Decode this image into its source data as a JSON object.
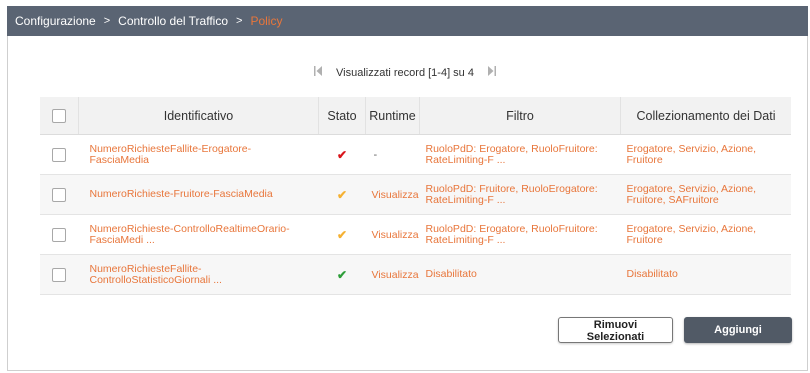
{
  "breadcrumb": {
    "items": [
      "Configurazione",
      "Controllo del Traffico",
      "Policy"
    ],
    "separator": ">"
  },
  "pager": {
    "prev_icon": "first-page-icon",
    "label": "Visualizzati record [1-4] su 4",
    "next_icon": "last-page-icon"
  },
  "table": {
    "columns": [
      "Identificativo",
      "Stato",
      "Runtime",
      "Filtro",
      "Collezionamento dei Dati"
    ],
    "rows": [
      {
        "id_line1": "NumeroRichiesteFallite-Erogatore-",
        "id_line2": "FasciaMedia",
        "stato_icon": "check-icon",
        "stato_color": "#d9161c",
        "runtime": "-",
        "filtro_line1": "RuoloPdD: Erogatore, RuoloFruitore:",
        "filtro_line2": "RateLimiting-F ...",
        "coll_line1": "Erogatore, Servizio, Azione,",
        "coll_line2": "Fruitore"
      },
      {
        "id_line1": "NumeroRichieste-Fruitore-FasciaMedia",
        "id_line2": "",
        "stato_icon": "check-icon",
        "stato_color": "#f5b133",
        "runtime": "Visualizza",
        "filtro_line1": "RuoloPdD: Fruitore, RuoloErogatore:",
        "filtro_line2": "RateLimiting-F ...",
        "coll_line1": "Erogatore, Servizio, Azione,",
        "coll_line2": "Fruitore, SAFruitore"
      },
      {
        "id_line1": "NumeroRichieste-ControlloRealtimeOrario-",
        "id_line2": "FasciaMedi ...",
        "stato_icon": "check-icon",
        "stato_color": "#f5b133",
        "runtime": "Visualizza",
        "filtro_line1": "RuoloPdD: Erogatore, RuoloFruitore:",
        "filtro_line2": "RateLimiting-F ...",
        "coll_line1": "Erogatore, Servizio, Azione,",
        "coll_line2": "Fruitore"
      },
      {
        "id_line1": "NumeroRichiesteFallite-",
        "id_line2": "ControlloStatisticoGiornali ...",
        "stato_icon": "check-icon",
        "stato_color": "#2e9e3a",
        "runtime": "Visualizza",
        "filtro_line1": "Disabilitato",
        "filtro_line2": "",
        "coll_line1": "Disabilitato",
        "coll_line2": ""
      }
    ]
  },
  "buttons": {
    "remove": "Rimuovi Selezionati",
    "add": "Aggiungi"
  },
  "colors": {
    "header_bar": "#5a6473",
    "accent": "#e8763b",
    "add_button": "#515a66"
  }
}
